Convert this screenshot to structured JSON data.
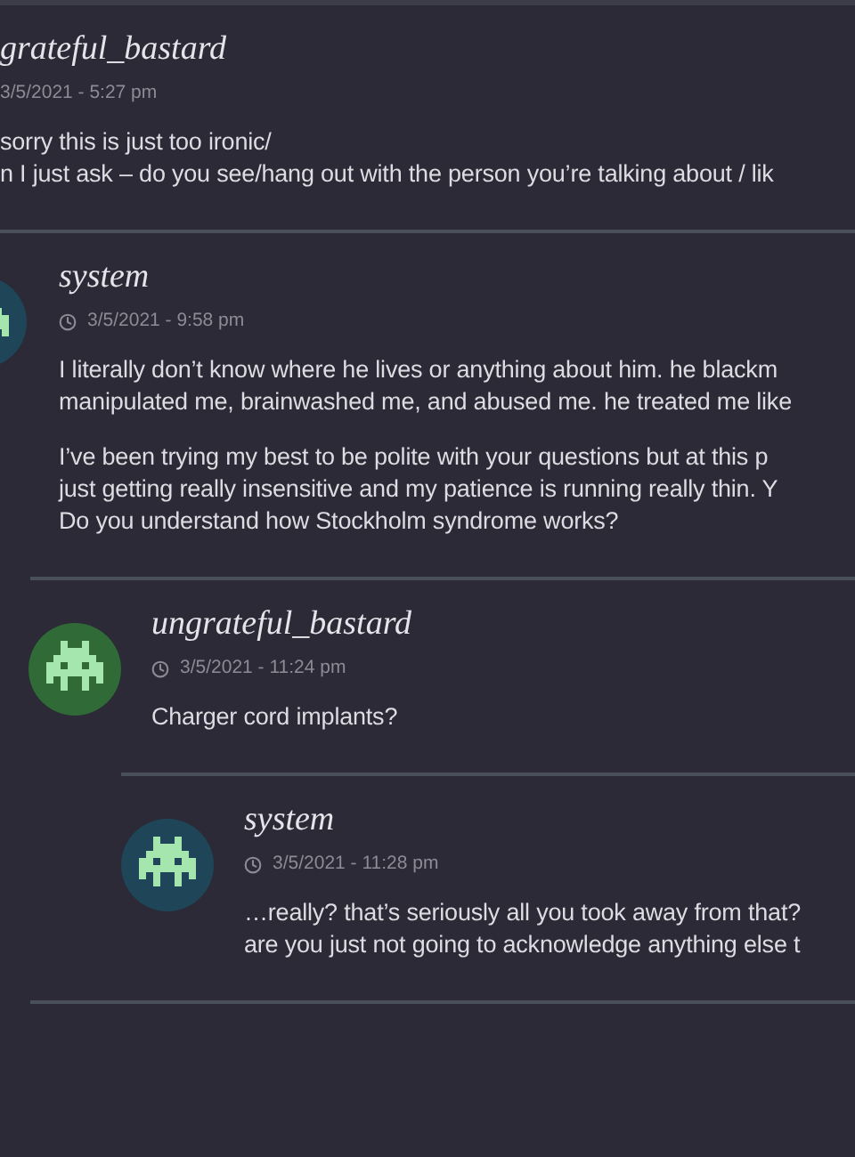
{
  "thread": {
    "author": "grateful_bastard",
    "timestamp": "3/5/2021 - 5:27 pm",
    "paragraphs": [
      [
        "sorry this is just too ironic/",
        "n I just ask – do you see/hang out with the person you’re talking about / lik"
      ]
    ],
    "children": [
      {
        "author": "system",
        "color": "#1e4658",
        "timestamp": "3/5/2021 - 9:58 pm",
        "paragraphs": [
          [
            "I literally don’t know where he lives or anything about him. he blackm",
            "manipulated me, brainwashed me, and abused me. he treated me like"
          ],
          [
            "I’ve been trying my best to be polite with your questions but at this p",
            "just getting really insensitive and my patience is running really thin. Y",
            "Do you understand how Stockholm syndrome works?"
          ]
        ],
        "children": [
          {
            "author": "ungrateful_bastard",
            "color": "#2f6a37",
            "timestamp": "3/5/2021 - 11:24 pm",
            "paragraphs": [
              [
                "Charger cord implants?"
              ]
            ],
            "children": [
              {
                "author": "system",
                "color": "#1e4658",
                "timestamp": "3/5/2021 - 11:28 pm",
                "paragraphs": [
                  [
                    "…really? that’s seriously all you took away from that?",
                    "are you just not going to acknowledge anything else t"
                  ]
                ]
              }
            ]
          }
        ]
      }
    ]
  }
}
